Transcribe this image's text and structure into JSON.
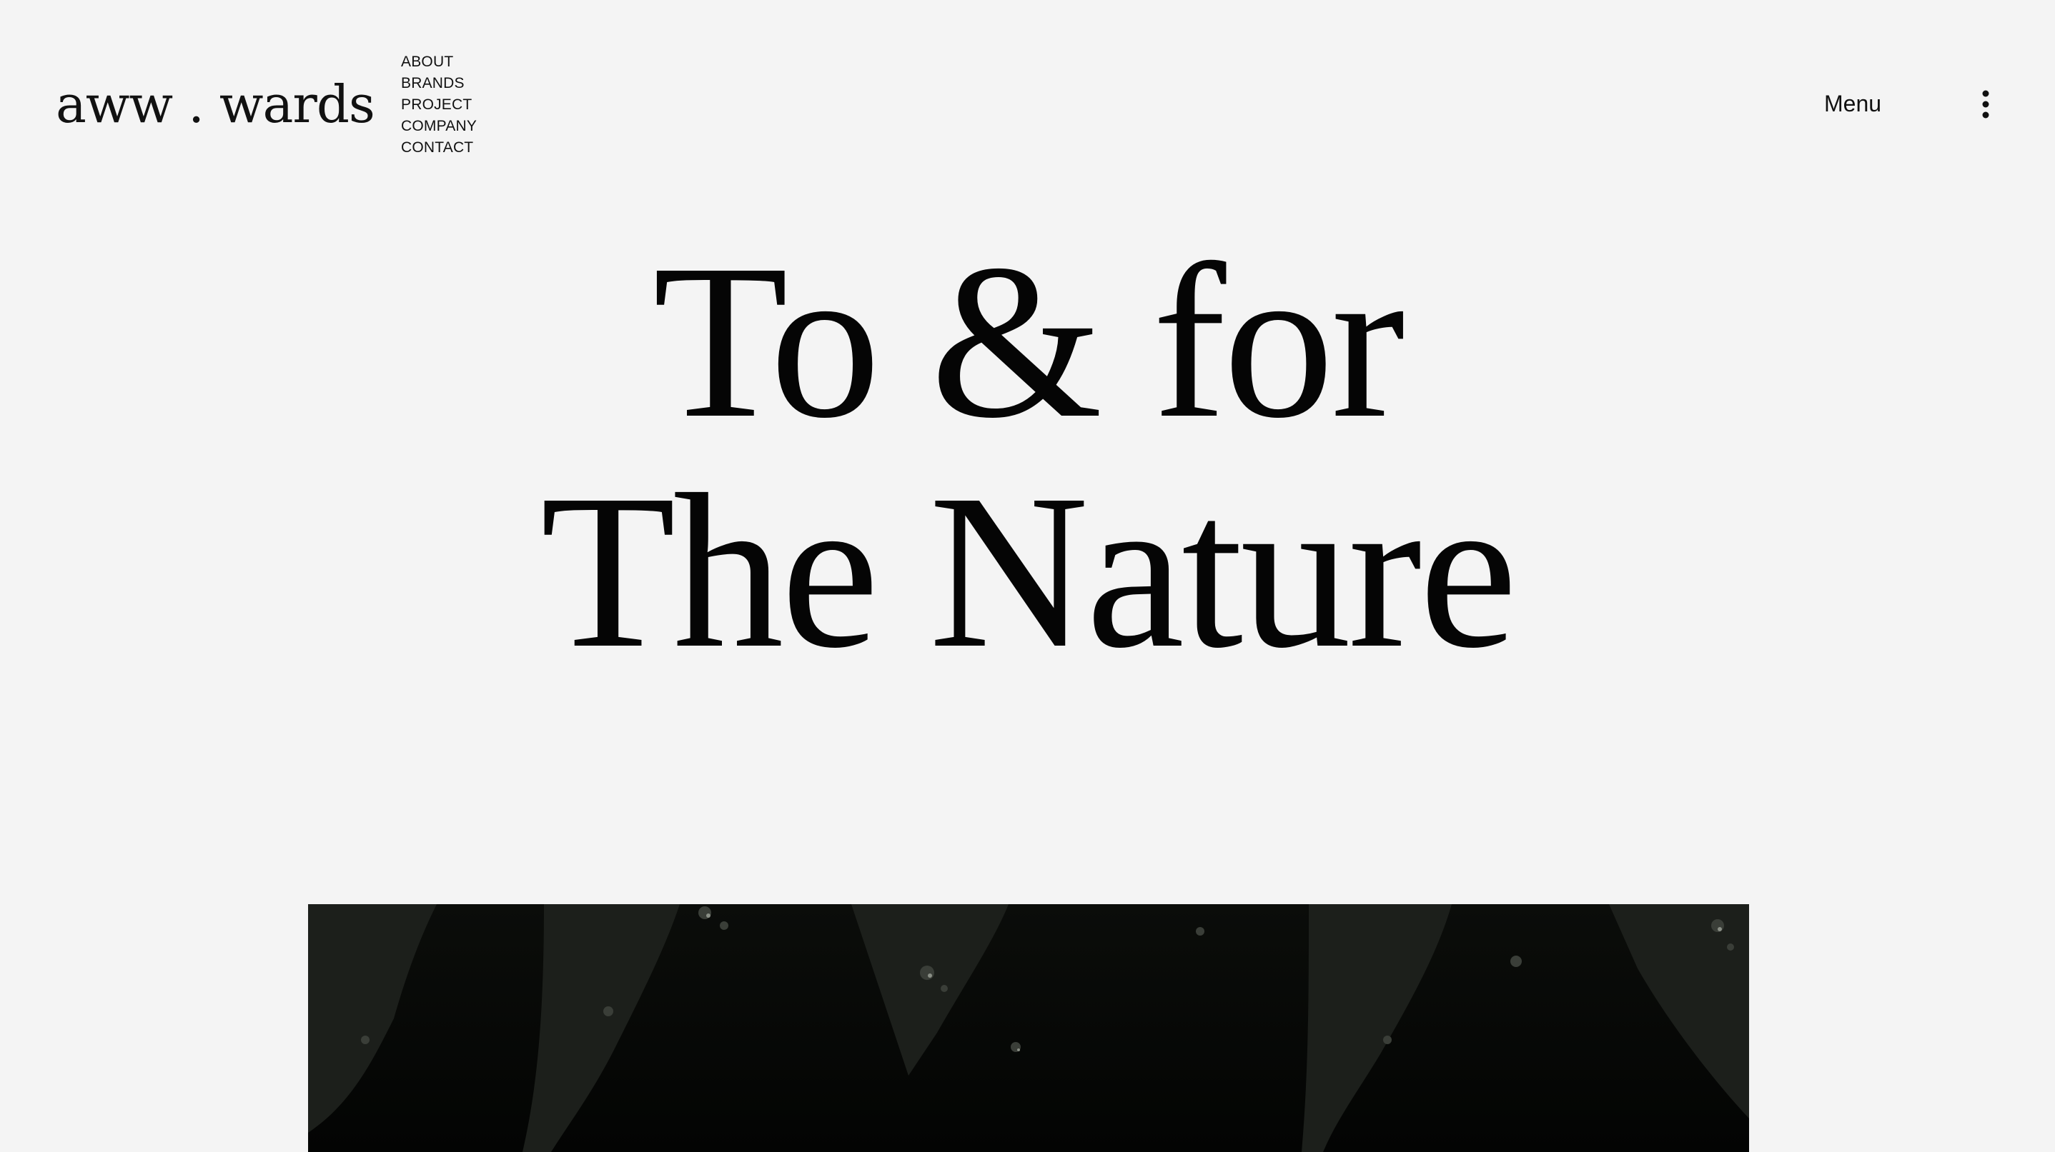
{
  "header": {
    "logo": "aww . wards",
    "nav": [
      "ABOUT",
      "BRANDS",
      "PROJECT",
      "COMPANY",
      "CONTACT"
    ],
    "menu_label": "Menu",
    "menu_icon": "more-vertical-icon"
  },
  "hero": {
    "line1": "To & for",
    "line2": "The Nature"
  },
  "media": {
    "image": "dark-forest-photo"
  },
  "colors": {
    "background": "#f4f4f4",
    "text": "#0a0a0a",
    "photo": "#050604"
  }
}
